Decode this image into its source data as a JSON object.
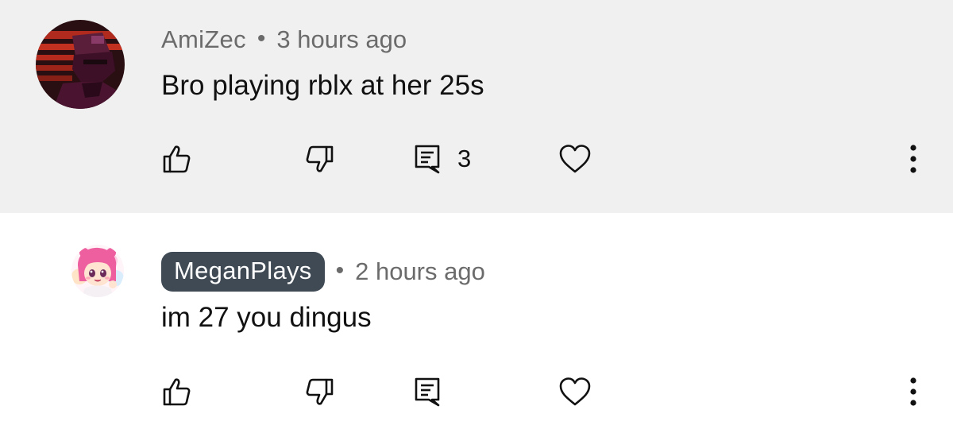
{
  "comments": [
    {
      "author": "AmiZec",
      "separator": "•",
      "time": "3 hours ago",
      "text": "Bro playing rblx at her 25s",
      "reply_count": "3",
      "avatar_icon": "hooded-figure-avatar",
      "highlighted": true
    },
    {
      "author": "MeganPlays",
      "separator": "•",
      "time": "2 hours ago",
      "text": "im 27 you dingus",
      "avatar_icon": "pink-hair-character-avatar",
      "author_badge": true
    }
  ],
  "colors": {
    "highlight_bg": "#f0f0f0",
    "badge_bg": "#3f4a55",
    "meta_text": "#6b6b6b",
    "body_text": "#111111"
  },
  "icons": [
    "thumbs-up-icon",
    "thumbs-down-icon",
    "reply-icon",
    "heart-icon",
    "more-vertical-icon"
  ]
}
